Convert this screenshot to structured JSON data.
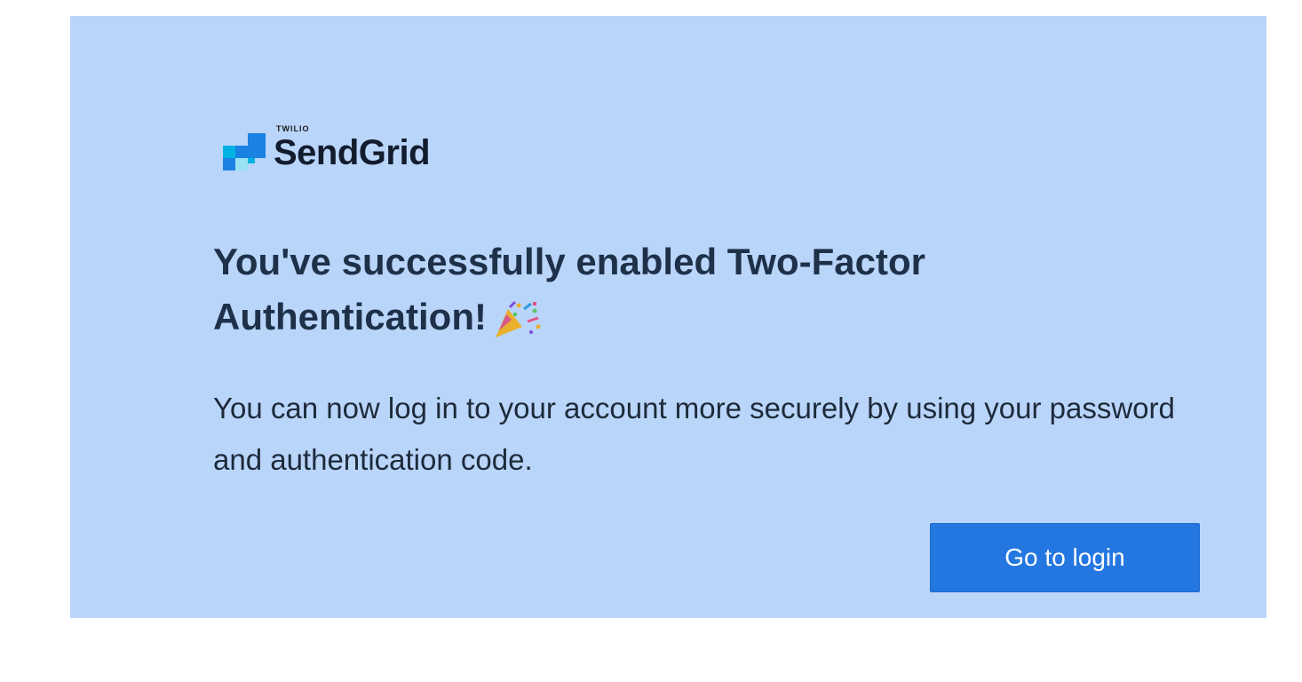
{
  "logo": {
    "overline": "TWILIO",
    "name": "SendGrid",
    "icon": "sendgrid-blocks-logo",
    "colors": [
      "#1a82e2",
      "#00b2e3",
      "#99e1f4",
      "#263746"
    ]
  },
  "headline": {
    "text": "You've successfully enabled Two-Factor Authentication!",
    "emoji": "party-popper-icon"
  },
  "message": "You can now log in to your account more securely by using your password and authentication code.",
  "button": {
    "label": "Go to login",
    "color": "#2477e0"
  },
  "colors": {
    "card_background": "#bad5fa",
    "page_background": "#ffffff",
    "heading": "#1e3149"
  }
}
